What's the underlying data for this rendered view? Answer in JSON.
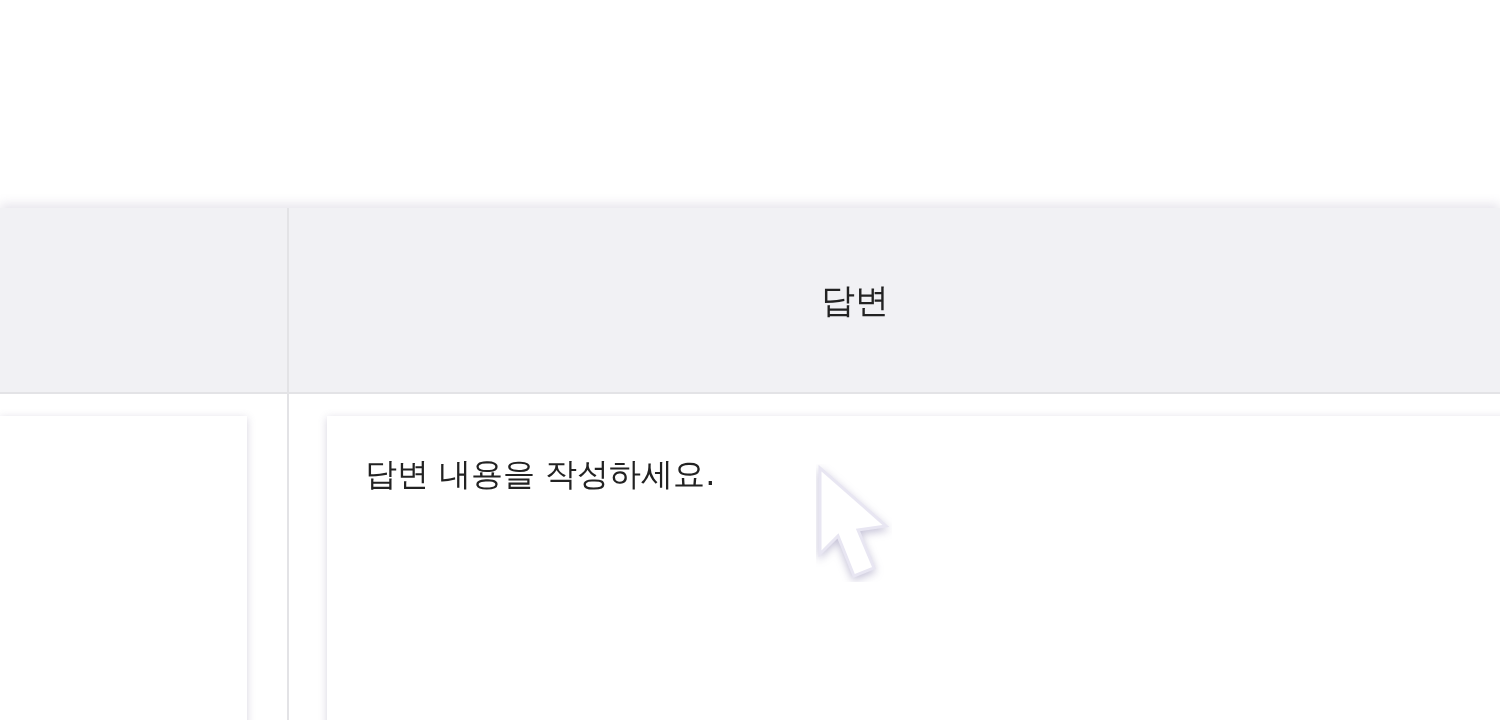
{
  "table": {
    "column_2_heading": "답변",
    "answer_field": {
      "placeholder": "답변 내용을 작성하세요."
    }
  }
}
